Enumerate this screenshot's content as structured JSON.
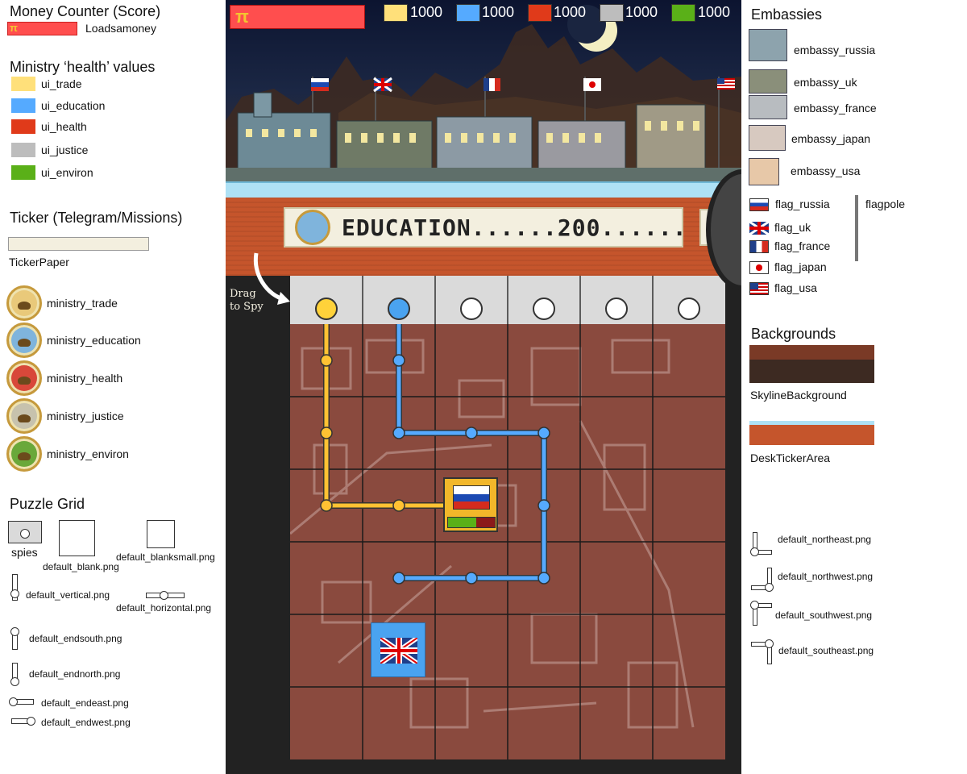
{
  "money": {
    "title": "Money Counter (Score)",
    "label": "Loadsamoney",
    "symbol": "π"
  },
  "ministry_health": {
    "title": "Ministry ‘health’ values",
    "items": [
      {
        "label": "ui_trade",
        "color": "#ffe07a"
      },
      {
        "label": "ui_education",
        "color": "#55aaff"
      },
      {
        "label": "ui_health",
        "color": "#e03a1a"
      },
      {
        "label": "ui_justice",
        "color": "#bdbdbd"
      },
      {
        "label": "ui_environ",
        "color": "#5ab018"
      }
    ]
  },
  "ticker": {
    "title": "Ticker (Telegram/Missions)",
    "paper_label": "TickerPaper",
    "text": "EDUCATION......200......"
  },
  "ministries": [
    {
      "label": "ministry_trade",
      "color": "#e9c97a"
    },
    {
      "label": "ministry_education",
      "color": "#7fb4dc"
    },
    {
      "label": "ministry_health",
      "color": "#d8483a"
    },
    {
      "label": "ministry_justice",
      "color": "#c7c2ad"
    },
    {
      "label": "ministry_environ",
      "color": "#6aa83a"
    }
  ],
  "puzzle": {
    "title": "Puzzle Grid",
    "spies": "spies",
    "blank": "default_blank.png",
    "blanksmall": "default_blanksmall.png",
    "vertical": "default_vertical.png",
    "horizontal": "default_horizontal.png",
    "endsouth": "default_endsouth.png",
    "endnorth": "default_endnorth.png",
    "endeast": "default_endeast.png",
    "endwest": "default_endwest.png"
  },
  "hud": {
    "values": [
      {
        "value": "1000",
        "color": "#ffe07a"
      },
      {
        "value": "1000",
        "color": "#55aaff"
      },
      {
        "value": "1000",
        "color": "#e03a1a"
      },
      {
        "value": "1000",
        "color": "#bdbdbd"
      },
      {
        "value": "1000",
        "color": "#5ab018"
      }
    ]
  },
  "game": {
    "drag_hint_line1": "Drag",
    "drag_hint_line2": "to Spy"
  },
  "embassies": {
    "title": "Embassies",
    "items": [
      "embassy_russia",
      "embassy_uk",
      "embassy_france",
      "embassy_japan",
      "embassy_usa"
    ]
  },
  "flags": {
    "items": [
      "flag_russia",
      "flag_uk",
      "flag_france",
      "flag_japan",
      "flag_usa"
    ],
    "flagpole": "flagpole"
  },
  "backgrounds": {
    "title": "Backgrounds",
    "skyline": "SkylineBackground",
    "desk": "DeskTickerArea"
  },
  "corners": {
    "northeast": "default_northeast.png",
    "northwest": "default_northwest.png",
    "southwest": "default_southwest.png",
    "southeast": "default_southeast.png"
  }
}
